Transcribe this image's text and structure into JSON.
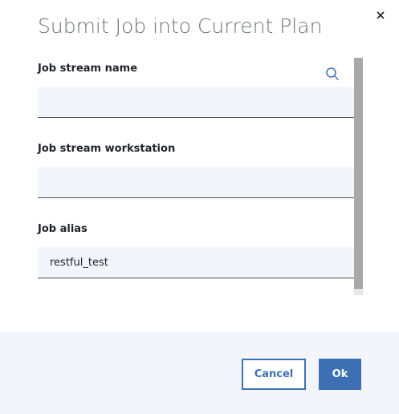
{
  "dialog": {
    "title": "Submit Job into Current Plan",
    "close_icon": "close-icon"
  },
  "fields": {
    "job_stream_name": {
      "label": "Job stream name",
      "value": "",
      "icon": "search-icon"
    },
    "job_stream_workstation": {
      "label": "Job stream workstation",
      "value": ""
    },
    "job_alias": {
      "label": "Job alias",
      "value": "restful_test"
    }
  },
  "footer": {
    "cancel_label": "Cancel",
    "ok_label": "Ok"
  },
  "colors": {
    "accent": "#3d70b2",
    "field_background": "#f2f5fa",
    "footer_background": "#f2f5fa",
    "title_text": "#6f7378"
  }
}
